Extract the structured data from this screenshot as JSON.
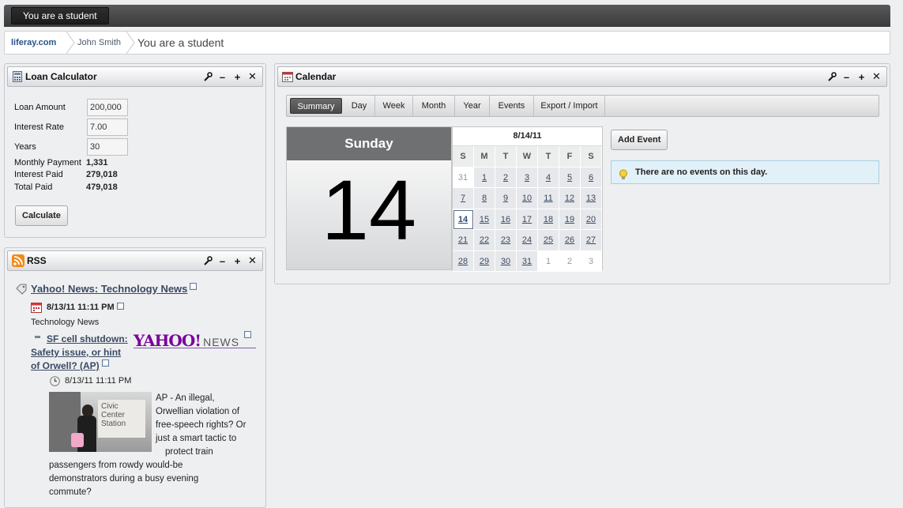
{
  "dock": {
    "tab_label": "You are a student"
  },
  "breadcrumb": {
    "items": [
      "liferay.com",
      "John Smith",
      "You are a student"
    ]
  },
  "loan_calculator": {
    "title": "Loan Calculator",
    "fields": {
      "loan_amount": {
        "label": "Loan Amount",
        "value": "200,000"
      },
      "interest_rate": {
        "label": "Interest Rate",
        "value": "7.00"
      },
      "years": {
        "label": "Years",
        "value": "30"
      }
    },
    "results": {
      "monthly_payment": {
        "label": "Monthly Payment",
        "value": "1,331"
      },
      "interest_paid": {
        "label": "Interest Paid",
        "value": "279,018"
      },
      "total_paid": {
        "label": "Total Paid",
        "value": "479,018"
      }
    },
    "calculate_label": "Calculate"
  },
  "rss": {
    "title": "RSS",
    "feed_title": "Yahoo! News: Technology News",
    "feed_date": "8/13/11 11:11 PM",
    "feed_category": "Technology News",
    "logo_text": "YAHOO!",
    "logo_sub": "NEWS",
    "entry": {
      "title_line1": "SF cell shutdown:",
      "title_line2": "Safety issue, or hint",
      "title_line3": "of Orwell? (AP)",
      "date": "8/13/11 11:11 PM",
      "image_sign_lines": [
        "Civic",
        "Center",
        "Station"
      ],
      "body_lines": [
        "AP - An illegal,",
        "Orwellian violation of",
        "free-speech rights? Or",
        "just a smart tactic to",
        "protect train"
      ],
      "body_tail": [
        "passengers from rowdy would-be",
        "demonstrators during a busy evening",
        "commute?"
      ]
    }
  },
  "calendar": {
    "title": "Calendar",
    "tabs": [
      "Summary",
      "Day",
      "Week",
      "Month",
      "Year",
      "Events",
      "Export / Import"
    ],
    "active_tab": "Summary",
    "weekday": "Sunday",
    "day_number": "14",
    "mini_title": "8/14/11",
    "weekday_headers": [
      "S",
      "M",
      "T",
      "W",
      "T",
      "F",
      "S"
    ],
    "weeks": [
      [
        "31",
        "1",
        "2",
        "3",
        "4",
        "5",
        "6"
      ],
      [
        "7",
        "8",
        "9",
        "10",
        "11",
        "12",
        "13"
      ],
      [
        "14",
        "15",
        "16",
        "17",
        "18",
        "19",
        "20"
      ],
      [
        "21",
        "22",
        "23",
        "24",
        "25",
        "26",
        "27"
      ],
      [
        "28",
        "29",
        "30",
        "31",
        "1",
        "2",
        "3"
      ]
    ],
    "add_event_label": "Add Event",
    "no_events_text": "There are no events on this day."
  },
  "colors": {
    "dock_bg": "#3a3a3a",
    "link": "#27538a",
    "info_bg": "#e2f0f8",
    "bigday_head": "#6e7072"
  }
}
